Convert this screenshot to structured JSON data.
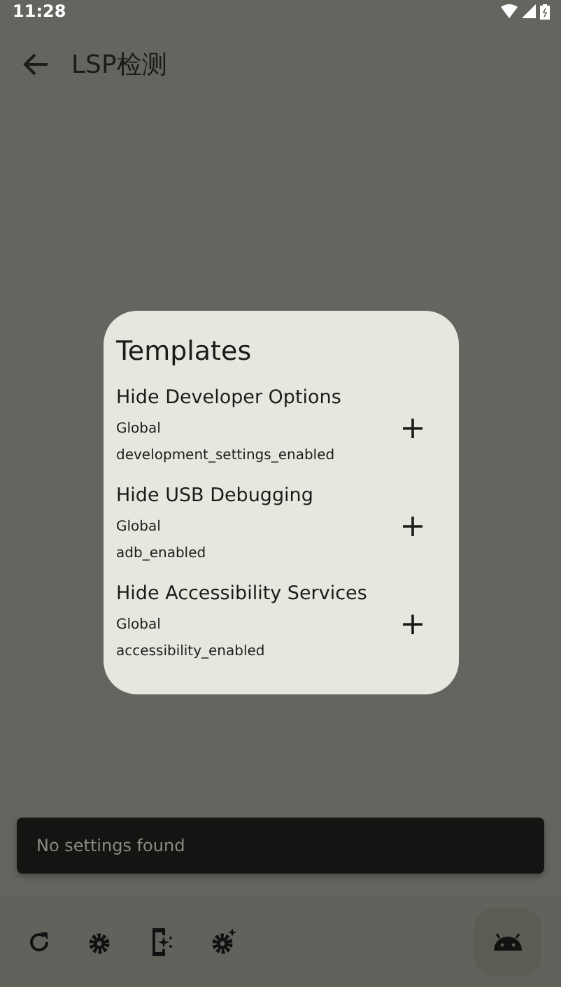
{
  "status_bar": {
    "time": "11:28"
  },
  "app_bar": {
    "title": "LSP检测"
  },
  "dialog": {
    "title": "Templates",
    "items": [
      {
        "name": "Hide Developer Options",
        "scope": "Global",
        "key": "development_settings_enabled"
      },
      {
        "name": "Hide USB Debugging",
        "scope": "Global",
        "key": "adb_enabled"
      },
      {
        "name": "Hide Accessibility Services",
        "scope": "Global",
        "key": "accessibility_enabled"
      }
    ]
  },
  "snackbar": {
    "message": "No settings found"
  }
}
